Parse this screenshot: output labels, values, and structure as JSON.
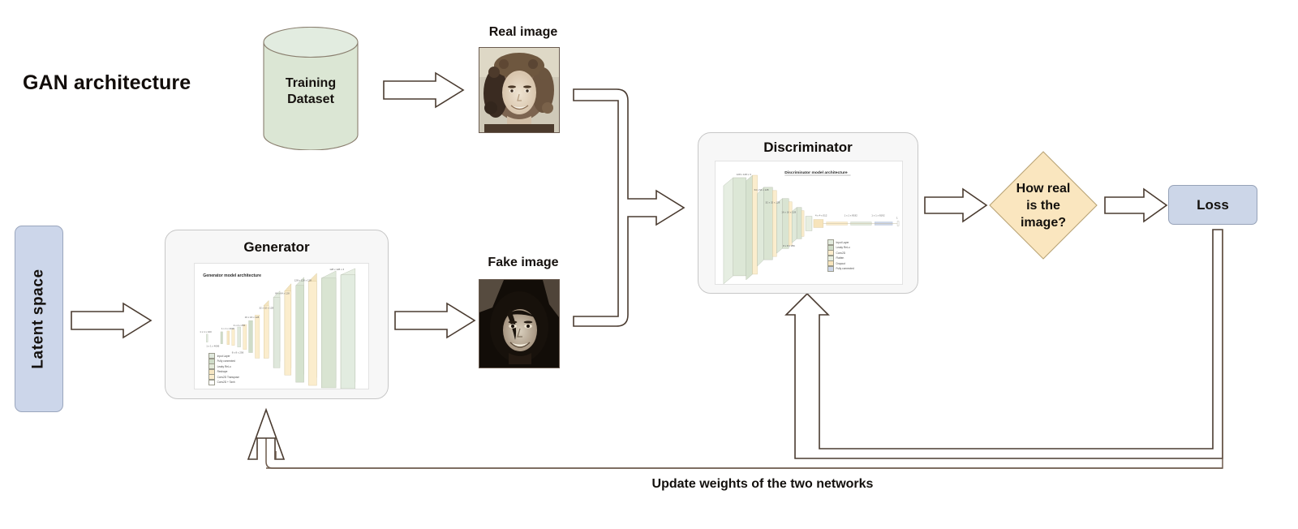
{
  "title": "GAN architecture",
  "nodes": {
    "latent_space": "Latent space",
    "training_dataset": "Training\nDataset",
    "training_dataset_line1": "Training",
    "training_dataset_line2": "Dataset",
    "real_image_caption": "Real image",
    "fake_image_caption": "Fake image",
    "generator_title": "Generator",
    "discriminator_title": "Discriminator",
    "decision_line1": "How real",
    "decision_line2": "is the",
    "decision_line3": "image?",
    "loss": "Loss",
    "update_caption": "Update weights of the two networks"
  },
  "generator_thumbnail": {
    "title": "Generator model architecture",
    "dim_labels": [
      "1 x 1 x 100",
      "1 x 1 x 4096",
      "1 x 1 x 4096",
      "4 x 4 x 256",
      "8 x 8 x 256",
      "16 x 16 x 128",
      "32 x 32 x 128",
      "64 x 64 x 128",
      "128 x 128 x 128",
      "128 x 128 x 3"
    ],
    "legend": [
      {
        "label": "Input Layer",
        "color": "#dfe8dc"
      },
      {
        "label": "Fully connected",
        "color": "#cfdcc8"
      },
      {
        "label": "Leaky ReLu",
        "color": "#e3ead9"
      },
      {
        "label": "Reshape",
        "color": "#f6e6c2"
      },
      {
        "label": "Conv2D Transpose",
        "color": "#fbedcd"
      },
      {
        "label": "Conv2D + Tanh",
        "color": "#ffffff"
      }
    ]
  },
  "discriminator_thumbnail": {
    "title": "Discriminator model architecture",
    "dim_labels": [
      "128 x 128 x 3",
      "64 x 64 x 128",
      "32 x 32 x 128",
      "16 x 16 x 128",
      "8 x 8 x 256",
      "4 x 4 x 512",
      "1 x 1 x 8192",
      "1 x 1 x 8192",
      "1 x 1 x 1",
      "1"
    ],
    "legend": [
      {
        "label": "Input Layer",
        "color": "#e2eadd"
      },
      {
        "label": "Leaky ReLu",
        "color": "#cfdcc8"
      },
      {
        "label": "Conv2D",
        "color": "#fbeccc"
      },
      {
        "label": "Flatten",
        "color": "#e7eee1"
      },
      {
        "label": "Dropout",
        "color": "#f7e4bb"
      },
      {
        "label": "Fully connected",
        "color": "#ccd6e8"
      }
    ]
  },
  "colors": {
    "cylinder_fill": "#dbe6d4",
    "cylinder_stroke": "#8a7f6f",
    "latent_fill": "#ccd6ea",
    "loss_fill": "#ccd6e8",
    "diamond_fill": "#fae6bf",
    "diamond_stroke": "#b9a375",
    "arrow_stroke": "#4a3b30",
    "connector_stroke": "#6d5a4c",
    "panel_fill": "#f7f7f7",
    "panel_stroke": "#c7c7c7"
  },
  "flow_arrows": [
    {
      "name": "latent-to-generator",
      "from": "Latent space",
      "to": "Generator"
    },
    {
      "name": "dataset-to-real-image",
      "from": "Training Dataset",
      "to": "Real image"
    },
    {
      "name": "generator-to-fake-image",
      "from": "Generator",
      "to": "Fake image"
    },
    {
      "name": "images-to-discriminator",
      "from": "Real image + Fake image",
      "to": "Discriminator"
    },
    {
      "name": "discriminator-to-decision",
      "from": "Discriminator",
      "to": "How real is the image?"
    },
    {
      "name": "decision-to-loss",
      "from": "How real is the image?",
      "to": "Loss"
    },
    {
      "name": "loss-to-discriminator-feedback",
      "from": "Loss",
      "to": "Discriminator"
    },
    {
      "name": "loss-to-generator-feedback",
      "from": "Loss",
      "to": "Generator"
    }
  ]
}
